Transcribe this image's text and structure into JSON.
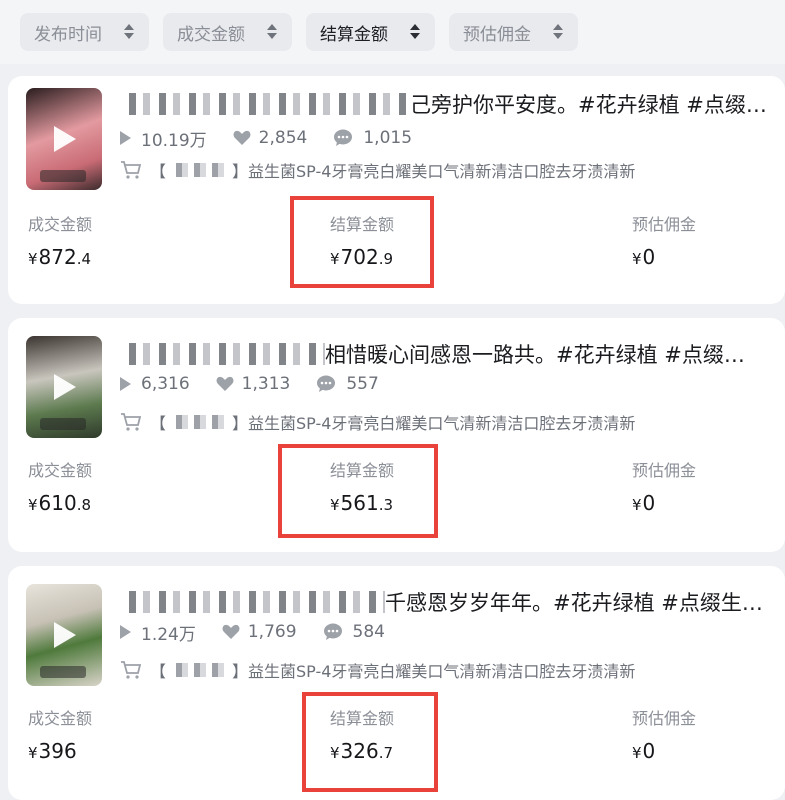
{
  "filters": [
    {
      "label": "发布时间",
      "active": false
    },
    {
      "label": "成交金额",
      "active": false
    },
    {
      "label": "结算金额",
      "active": true
    },
    {
      "label": "预估佣金",
      "active": false
    }
  ],
  "currency": "¥",
  "metric_labels": {
    "deal": "成交金额",
    "settle": "结算金额",
    "commission": "预估佣金"
  },
  "product_title_suffix": "】益生菌SP-4牙膏亮白耀美口气清新清洁口腔去牙渍清新",
  "product_title_prefix": "【",
  "cards": [
    {
      "title_visible": "己旁护你平安度。#花卉绿植 #点缀…",
      "views": "10.19万",
      "likes": "2,854",
      "comments": "1,015",
      "deal_int": "872",
      "deal_dec": ".4",
      "settle_int": "702",
      "settle_dec": ".9",
      "commission": "0",
      "thumb_color": "#d98a8f"
    },
    {
      "title_visible": "相惜暖心间感恩一路共。#花卉绿植 #点缀…",
      "views": "6,316",
      "likes": "1,313",
      "comments": "557",
      "deal_int": "610",
      "deal_dec": ".8",
      "settle_int": "561",
      "settle_dec": ".3",
      "commission": "0",
      "thumb_color": "#7c8a80"
    },
    {
      "title_visible": "千感恩岁岁年年。#花卉绿植 #点缀生…",
      "views": "1.24万",
      "likes": "1,769",
      "comments": "584",
      "deal_int": "396",
      "deal_dec": "",
      "settle_int": "326",
      "settle_dec": ".7",
      "commission": "0",
      "thumb_color": "#6f8d5e"
    }
  ],
  "colors": {
    "highlight": "#e8423a",
    "background": "#eef0f3"
  }
}
